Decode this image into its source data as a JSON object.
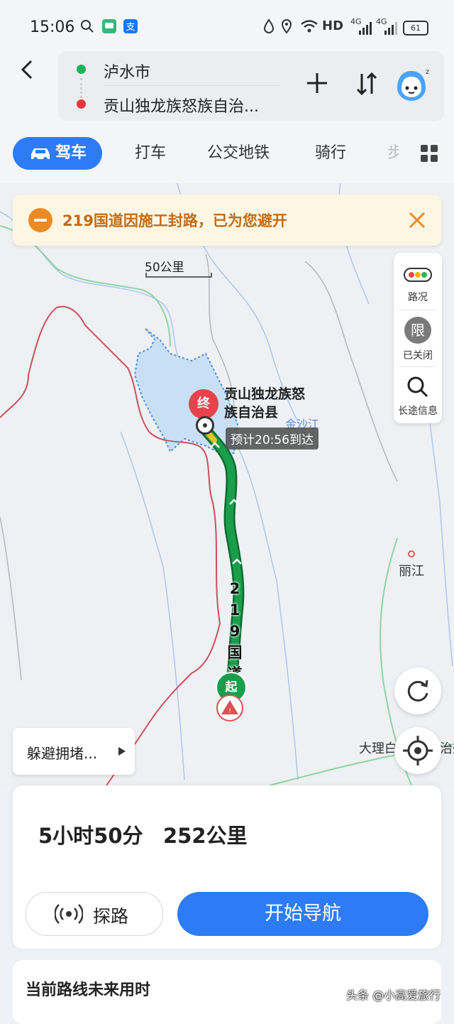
{
  "status_bar": {
    "time": "15:06",
    "battery": "61",
    "network": "HD",
    "signal1": "4G",
    "signal2": "4G"
  },
  "route": {
    "origin": "泸水市",
    "destination": "贡山独龙族怒族自治..."
  },
  "tabs": [
    "驾车",
    "打车",
    "公交地铁",
    "骑行",
    "步"
  ],
  "alert": {
    "text": "219国道因施工封路，已为您避开"
  },
  "side_tools": {
    "traffic_label": "路况",
    "restrict_glyph": "限",
    "restrict_label": "已关闭",
    "longtrip_label": "长途信息"
  },
  "map": {
    "dest_marker": "终",
    "start_marker": "起",
    "dest_name_line1": "贡山独龙族怒",
    "dest_name_line2": "族自治县",
    "eta": "预计20:56到达",
    "river_label": "金沙江",
    "city_lijiang": "丽江",
    "city_dali": "大理白",
    "city_dali_tail": "治州",
    "road_label": [
      "2",
      "1",
      "9",
      "国",
      "道"
    ],
    "scale": "50公里",
    "avoid_congestion": "躲避拥堵...",
    "colors": {
      "route": "#1a9e4b",
      "route_border": "#0b6b31",
      "accent": "#2d7cf6",
      "boundary": "#c9515e"
    }
  },
  "summary": {
    "duration": "5小时50分",
    "distance": "252公里",
    "explore": "探路",
    "navigate": "开始导航"
  },
  "future": {
    "title": "当前路线未来用时"
  },
  "watermark": "头条 @小高爱旅行"
}
